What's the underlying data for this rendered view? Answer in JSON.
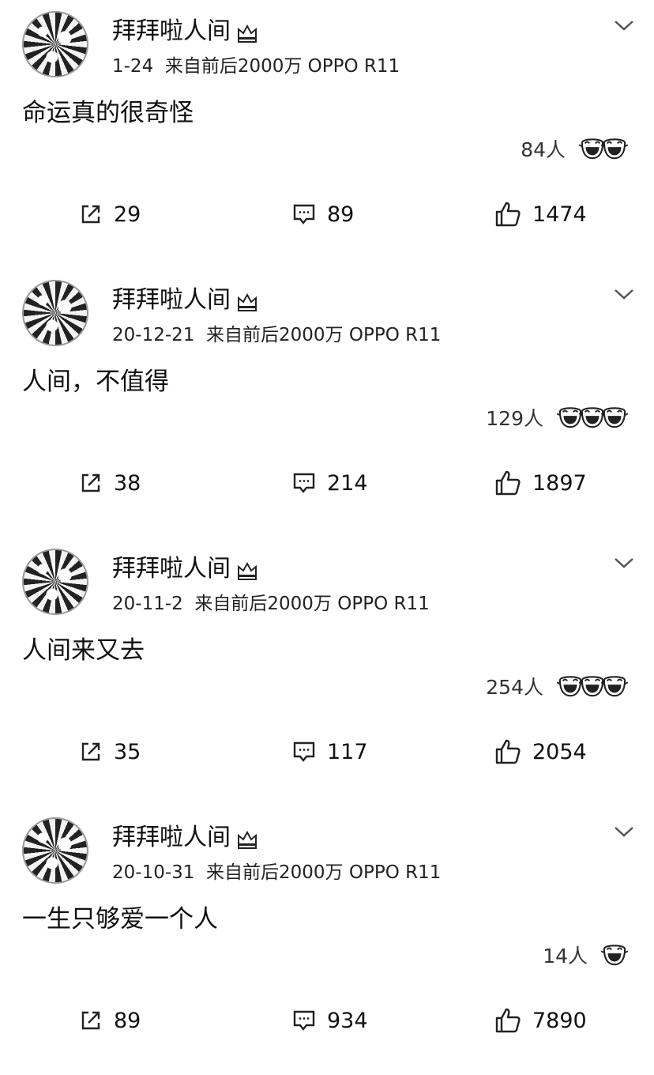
{
  "posts": [
    {
      "username": "拜拜啦人间",
      "meta": "1-24  来自前后2000万 OPPO R11",
      "content": "命运真的很奇怪",
      "reaction_count": "84人",
      "reaction_emojis": 2,
      "reposts": "29",
      "comments": "89",
      "likes": "1474"
    },
    {
      "username": "拜拜啦人间",
      "meta": "20-12-21  来自前后2000万 OPPO R11",
      "content": "人间，不值得",
      "reaction_count": "129人",
      "reaction_emojis": 3,
      "reposts": "38",
      "comments": "214",
      "likes": "1897"
    },
    {
      "username": "拜拜啦人间",
      "meta": "20-11-2  来自前后2000万 OPPO R11",
      "content": "人间来又去",
      "reaction_count": "254人",
      "reaction_emojis": 3,
      "reposts": "35",
      "comments": "117",
      "likes": "2054"
    },
    {
      "username": "拜拜啦人间",
      "meta": "20-10-31  来自前后2000万 OPPO R11",
      "content": "一生只够爱一个人",
      "reaction_count": "14人",
      "reaction_emojis": 1,
      "reposts": "89",
      "comments": "934",
      "likes": "7890"
    }
  ],
  "icons": {
    "verified": "crown-badge-icon",
    "more": "chevron-down-icon",
    "reaction": "laughing-emoji-icon",
    "repost": "repost-icon",
    "comment": "comment-icon",
    "like": "thumbs-up-icon"
  }
}
